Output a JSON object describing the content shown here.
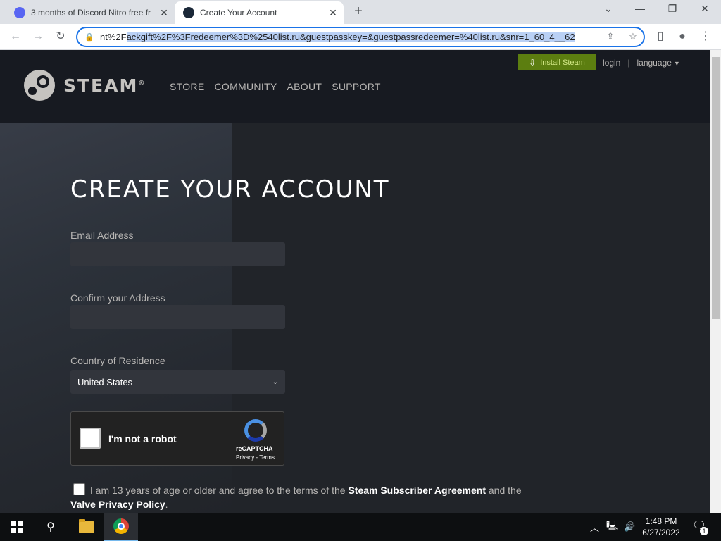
{
  "browser": {
    "tabs": [
      {
        "title": "3 months of Discord Nitro free fr",
        "icon": "discord-icon"
      },
      {
        "title": "Create Your Account",
        "icon": "steam-icon"
      }
    ],
    "tab_close": "✕",
    "new_tab": "+",
    "url_prefix": "nt%2F",
    "url_selected": "ackgift%2F%3Fredeemer%3D%2540list.ru&guestpasskey=&guestpassredeemer=%40list.ru&snr=1_60_4__62",
    "window_controls": {
      "minimize": "—",
      "restore": "❐",
      "close": "✕",
      "tab_search": "⌄"
    }
  },
  "steam_header": {
    "logo_text": "STEAM",
    "logo_reg": "®",
    "nav": [
      "STORE",
      "COMMUNITY",
      "ABOUT",
      "SUPPORT"
    ],
    "install_label": "Install Steam",
    "login_label": "login",
    "language_label": "language",
    "separator": "|"
  },
  "form": {
    "title": "CREATE YOUR ACCOUNT",
    "email_label": "Email Address",
    "email_value": "",
    "confirm_label": "Confirm your Address",
    "confirm_value": "",
    "country_label": "Country of Residence",
    "country_value": "United States",
    "recaptcha": {
      "label": "I'm not a robot",
      "brand": "reCAPTCHA",
      "terms": "Privacy - Terms"
    },
    "agree_prefix": "I am 13 years of age or older and agree to the terms of the",
    "agree_ssa": "Steam Subscriber Agreement",
    "agree_and": "and the",
    "agree_privacy": "Valve Privacy Policy",
    "agree_end": "."
  },
  "taskbar": {
    "time": "1:48 PM",
    "date": "6/27/2022",
    "notification_count": "1"
  },
  "colors": {
    "steam_header_bg": "#171a21",
    "steam_content_bg": "#212429",
    "install_button": "#5c7e10",
    "omnibox_focus": "#1a73e8",
    "discord_brand": "#5865f2"
  }
}
